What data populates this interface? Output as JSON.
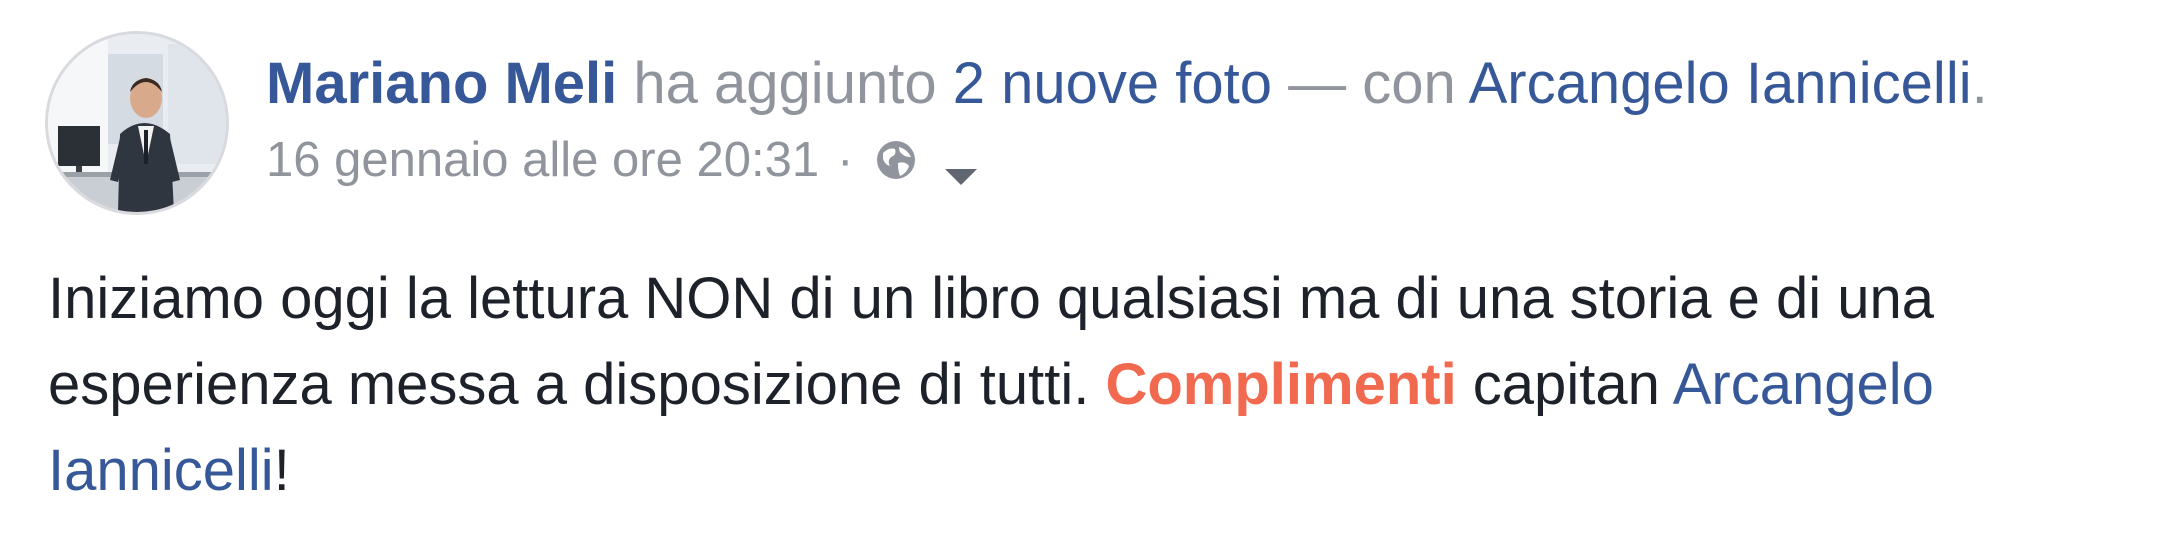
{
  "post": {
    "author": "Mariano Meli",
    "action_text": " ha aggiunto ",
    "photos_link": "2 nuove foto",
    "with_text": " — con ",
    "tagged_user": "Arcangelo Iannicelli",
    "period": ".",
    "timestamp": "16 gennaio alle ore 20:31",
    "separator": "·",
    "privacy_icon": "globe-icon",
    "menu_icon": "caret-down-icon",
    "body": {
      "part1": "Iniziamo oggi la lettura NON di un libro qualsiasi ma di una storia e di una esperienza messa a disposizione di tutti. ",
      "highlight": "Complimenti",
      "part2": " capitan ",
      "mention": "Arcangelo Iannicelli",
      "end": "!"
    },
    "colors": {
      "link": "#365899",
      "muted": "#90949c",
      "text": "#1d2129",
      "highlight": "#f16a4f"
    }
  }
}
